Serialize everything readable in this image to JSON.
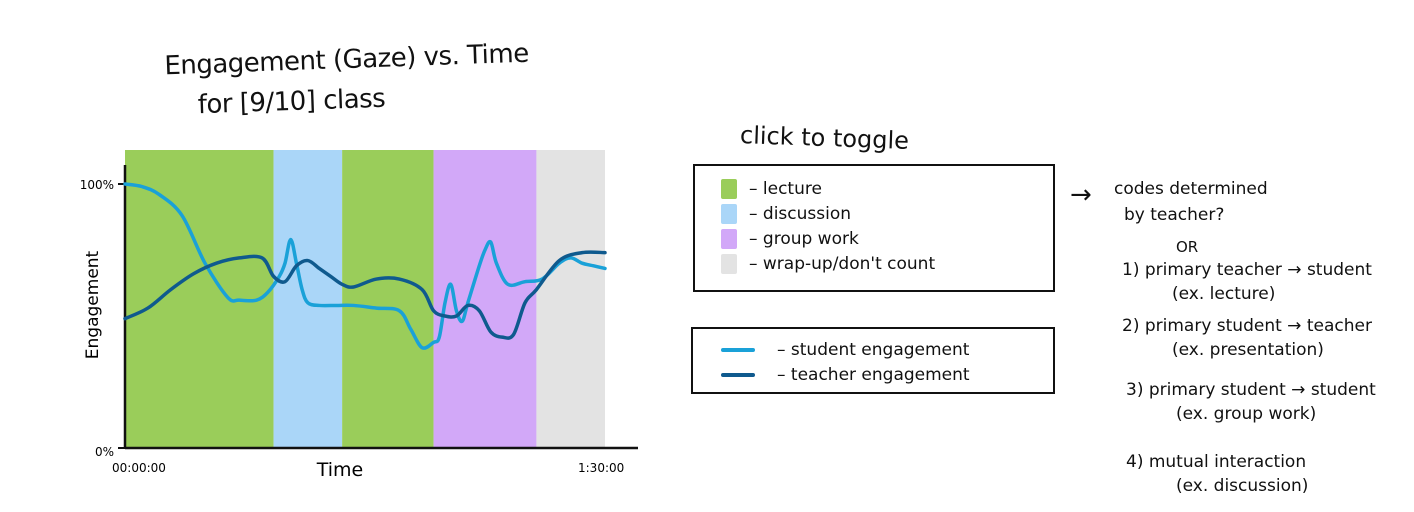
{
  "chart_data": {
    "type": "area",
    "title": "Engagement (Gaze) vs. Time",
    "subtitle": "for [9/10] class",
    "xlabel": "Time",
    "ylabel": "Engagement",
    "x_tick_labels": [
      "00:00:00",
      "1:30:00"
    ],
    "y_tick_labels": [
      "0%",
      "100%"
    ],
    "ylim": [
      0,
      100
    ],
    "x_range_minutes": [
      0,
      90
    ],
    "phases": [
      {
        "label": "lecture",
        "start": 0,
        "end": 26,
        "color": "#9acd5a"
      },
      {
        "label": "discussion",
        "start": 26,
        "end": 38,
        "color": "#aad6f8"
      },
      {
        "label": "lecture",
        "start": 38,
        "end": 54,
        "color": "#9acd5a"
      },
      {
        "label": "group work",
        "start": 54,
        "end": 72,
        "color": "#d2a8f8"
      },
      {
        "label": "wrap-up/don't count",
        "start": 72,
        "end": 84,
        "color": "#e3e3e3"
      }
    ],
    "series": [
      {
        "name": "student engagement",
        "color": "#1aa1d8",
        "x": [
          0,
          3,
          6,
          10,
          14,
          18,
          20,
          23,
          25,
          27,
          28,
          29,
          30,
          31,
          32,
          34,
          37,
          40,
          44,
          48,
          50,
          52,
          54,
          55,
          56,
          57,
          58,
          59,
          60,
          62,
          63,
          64,
          65,
          67,
          70,
          73,
          76,
          78,
          80,
          82,
          84
        ],
        "y": [
          100,
          99,
          96,
          88,
          70,
          57,
          56,
          56,
          59,
          65,
          70,
          79,
          70,
          60,
          55,
          54,
          54,
          54,
          53,
          52,
          45,
          38,
          40,
          42,
          55,
          62,
          52,
          48,
          55,
          69,
          75,
          78,
          70,
          62,
          63,
          64,
          70,
          72,
          70,
          69,
          68
        ]
      },
      {
        "name": "teacher engagement",
        "color": "#0f5a8e",
        "x": [
          0,
          4,
          8,
          12,
          16,
          20,
          24,
          26,
          28,
          30,
          32,
          34,
          36,
          38,
          40,
          44,
          48,
          52,
          54,
          56,
          58,
          60,
          62,
          64,
          66,
          68,
          70,
          72,
          76,
          80,
          84
        ],
        "y": [
          49,
          53,
          60,
          66,
          70,
          72,
          72,
          65,
          63,
          69,
          71,
          68,
          65,
          62,
          61,
          64,
          64,
          60,
          52,
          50,
          50,
          54,
          52,
          44,
          42,
          43,
          55,
          60,
          71,
          74,
          74
        ]
      }
    ],
    "grid": false,
    "legend": "right"
  },
  "toggle_label": "click to toggle",
  "phase_legend": [
    {
      "label": "lecture",
      "color": "#9acd5a"
    },
    {
      "label": "discussion",
      "color": "#aad6f8"
    },
    {
      "label": "group work",
      "color": "#d2a8f8"
    },
    {
      "label": "wrap-up/don't count",
      "color": "#e3e3e3"
    }
  ],
  "series_legend": [
    {
      "label": "student engagement",
      "color": "#1aa1d8"
    },
    {
      "label": "teacher engagement",
      "color": "#0f5a8e"
    }
  ],
  "notes": {
    "arrow": "→",
    "heading_1": "codes determined",
    "heading_2": "by teacher?",
    "or": "OR",
    "items": [
      {
        "main": "1) primary teacher → student",
        "example": "(ex. lecture)"
      },
      {
        "main": "2) primary student → teacher",
        "example": "(ex. presentation)"
      },
      {
        "main": "3) primary student → student",
        "example": "(ex. group work)"
      },
      {
        "main": "4) mutual interaction",
        "example": "(ex. discussion)"
      }
    ]
  }
}
